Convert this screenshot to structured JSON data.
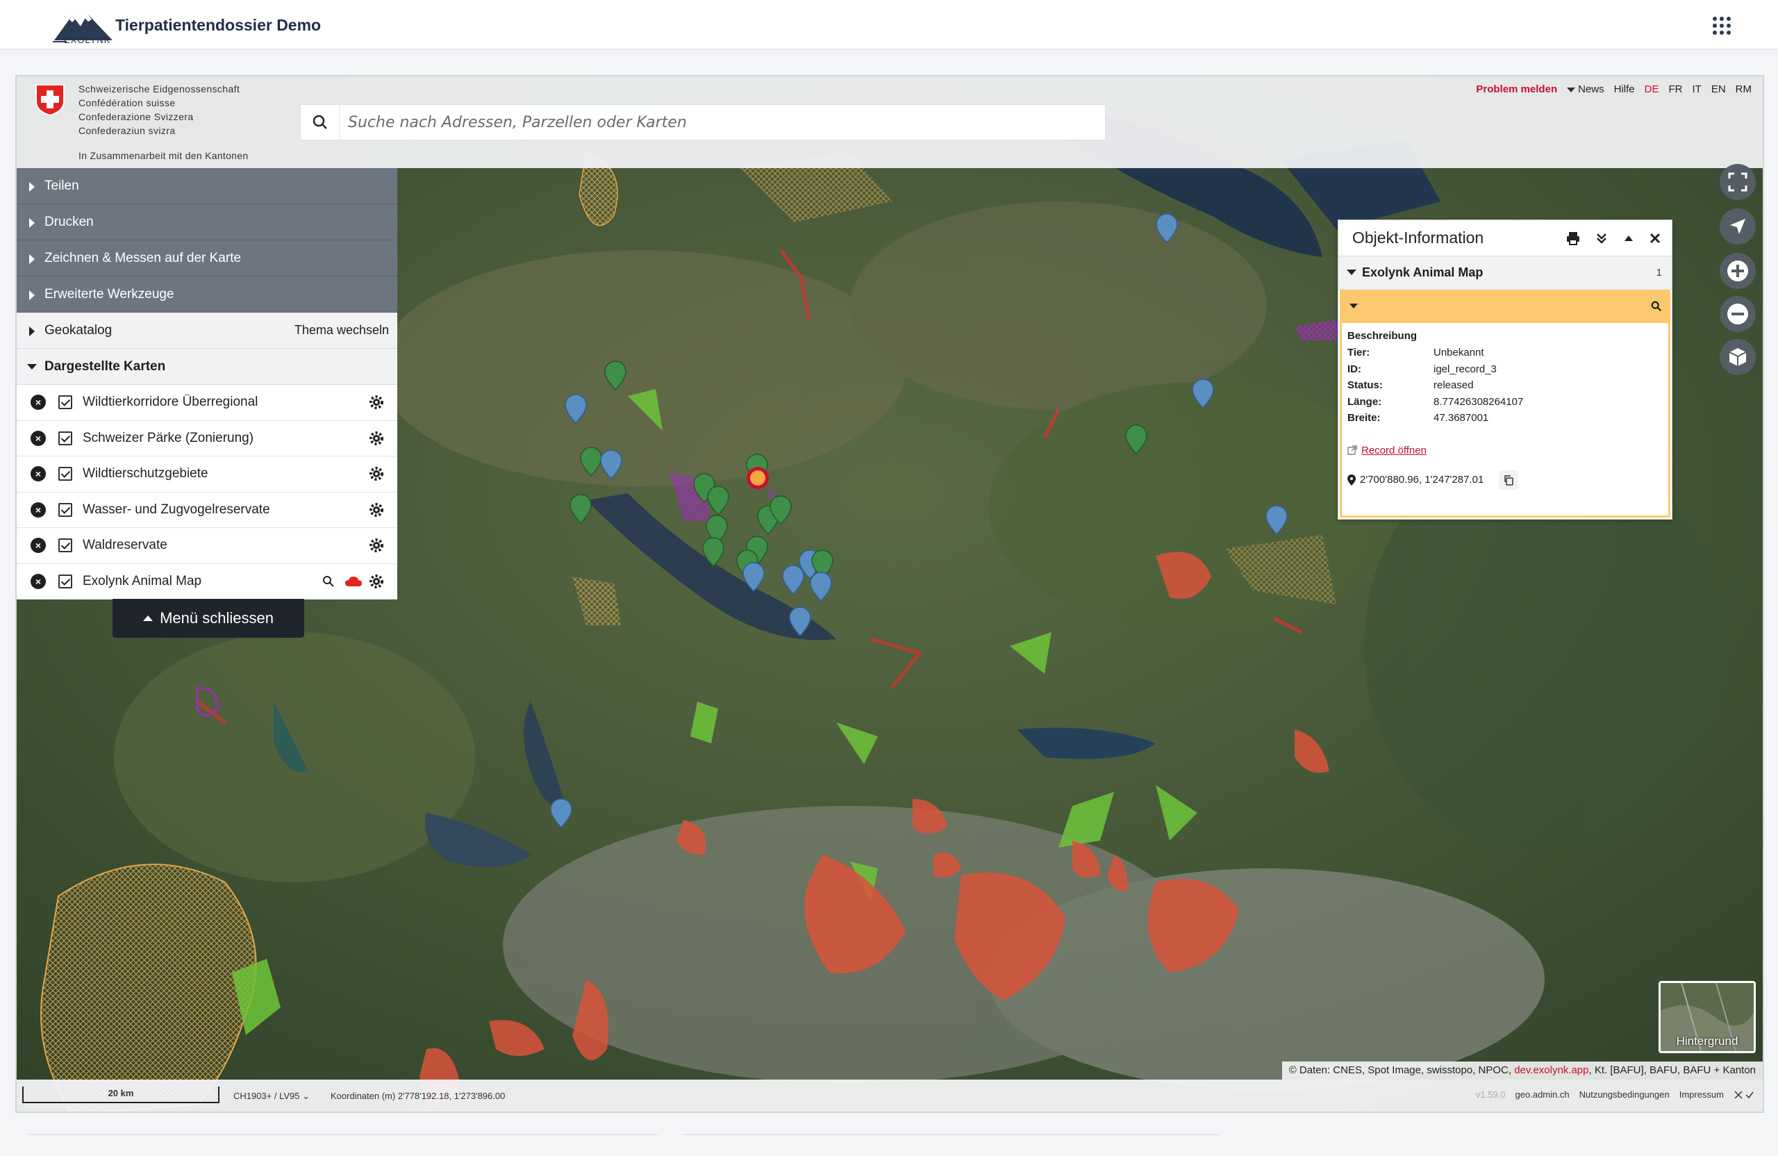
{
  "app": {
    "title": "Tierpatientendossier Demo",
    "logo_text": "EXOLYNK"
  },
  "header": {
    "confederation": [
      "Schweizerische Eidgenossenschaft",
      "Confédération suisse",
      "Confederazione Svizzera",
      "Confederaziun svizra"
    ],
    "cantons_note": "In Zusammenarbeit mit den Kantonen",
    "search_placeholder": "Suche nach Adressen, Parzellen oder Karten",
    "nav": {
      "problem": "Problem melden",
      "news": "News",
      "help": "Hilfe",
      "languages": [
        "DE",
        "FR",
        "IT",
        "EN",
        "RM"
      ],
      "active_language": "DE"
    }
  },
  "menu": {
    "sections": [
      "Teilen",
      "Drucken",
      "Zeichnen & Messen auf der Karte",
      "Erweiterte Werkzeuge"
    ],
    "geocatalog": "Geokatalog",
    "change_theme": "Thema wechseln",
    "displayed_maps": "Dargestellte Karten",
    "layers": [
      "Wildtierkorridore Überregional",
      "Schweizer Pärke (Zonierung)",
      "Wildtierschutzgebiete",
      "Wasser- und Zugvogelreservate",
      "Waldreservate",
      "Exolynk Animal Map"
    ],
    "close_menu": "Menü schliessen"
  },
  "popup": {
    "title": "Objekt-Information",
    "layer": "Exolynk Animal Map",
    "count": "1",
    "description_title": "Beschreibung",
    "attributes": [
      {
        "key": "Tier:",
        "value": "Unbekannt"
      },
      {
        "key": "ID:",
        "value": "igel_record_3"
      },
      {
        "key": "Status:",
        "value": "released"
      },
      {
        "key": "Länge:",
        "value": "8.77426308264107"
      },
      {
        "key": "Breite:",
        "value": "47.3687001"
      }
    ],
    "record_link": "Record öffnen",
    "coordinates": "2'700'880.96, 1'247'287.01"
  },
  "map": {
    "background_label": "Hintergrund",
    "attribution_prefix": "© Daten: CNES, Spot Image, swisstopo, NPOC,",
    "attribution_link": "dev.exolynk.app",
    "attribution_suffix": ", Kt. [BAFU], BAFU, BAFU + Kanton",
    "pin_colors": {
      "green": "#3f8f48",
      "blue": "#5b8fc4",
      "selected": "#f4a640"
    }
  },
  "footer": {
    "scale": "20 km",
    "crs": "CH1903+ / LV95",
    "coordinates": "Koordinaten (m) 2'778'192.18, 1'273'896.00",
    "version": "v1.59.0",
    "links": [
      "geo.admin.ch",
      "Nutzungsbedingungen",
      "Impressum"
    ]
  }
}
